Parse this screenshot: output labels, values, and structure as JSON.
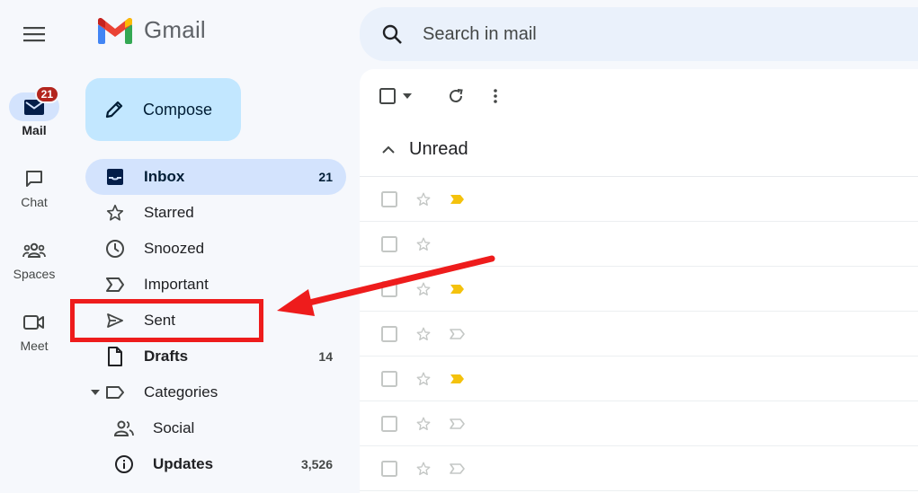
{
  "rail": {
    "items": [
      {
        "label": "Mail",
        "icon": "mail-icon",
        "badge": "21",
        "active": true
      },
      {
        "label": "Chat",
        "icon": "chat-icon"
      },
      {
        "label": "Spaces",
        "icon": "spaces-icon"
      },
      {
        "label": "Meet",
        "icon": "meet-icon"
      }
    ]
  },
  "app": {
    "name": "Gmail"
  },
  "compose": {
    "label": "Compose"
  },
  "search": {
    "placeholder": "Search in mail"
  },
  "nav": {
    "items": [
      {
        "label": "Inbox",
        "count": "21",
        "icon": "inbox-icon"
      },
      {
        "label": "Starred",
        "count": "",
        "icon": "star-icon"
      },
      {
        "label": "Snoozed",
        "count": "",
        "icon": "clock-icon"
      },
      {
        "label": "Important",
        "count": "",
        "icon": "important-icon"
      },
      {
        "label": "Sent",
        "count": "",
        "icon": "send-icon"
      },
      {
        "label": "Drafts",
        "count": "14",
        "icon": "draft-icon"
      },
      {
        "label": "Categories",
        "count": "",
        "icon": "label-icon"
      },
      {
        "label": "Social",
        "count": "",
        "icon": "people-icon"
      },
      {
        "label": "Updates",
        "count": "3,526",
        "icon": "info-icon"
      }
    ]
  },
  "main": {
    "section_title": "Unread"
  },
  "colors": {
    "active_bg": "#d3e3fd",
    "compose_bg": "#c2e7ff",
    "annotation": "#ee1c1c",
    "important_marker": "#f4c20d"
  }
}
